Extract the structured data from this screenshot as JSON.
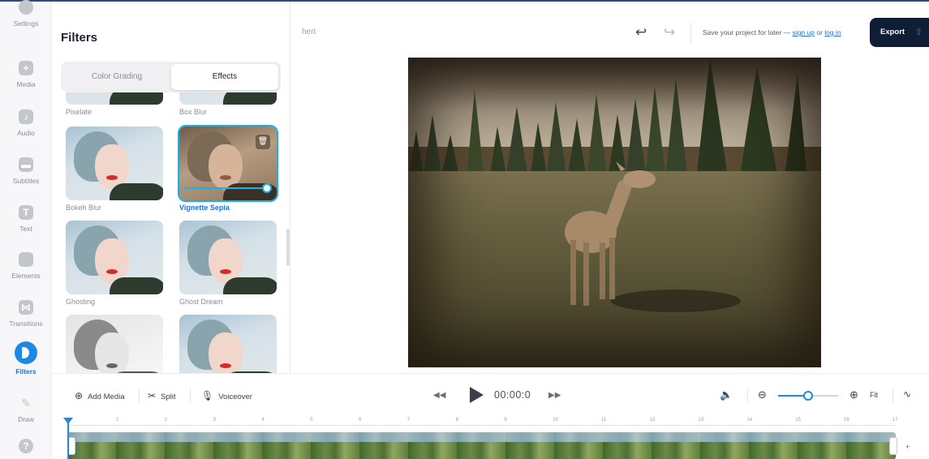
{
  "sidebar": {
    "items": [
      {
        "label": "Settings",
        "icon": "settings-icon"
      },
      {
        "label": "Media",
        "icon": "plus-icon"
      },
      {
        "label": "Audio",
        "icon": "music-note-icon"
      },
      {
        "label": "Subtitles",
        "icon": "subtitles-icon"
      },
      {
        "label": "Text",
        "icon": "text-icon"
      },
      {
        "label": "Elements",
        "icon": "elements-icon"
      },
      {
        "label": "Transitions",
        "icon": "transitions-icon"
      },
      {
        "label": "Filters",
        "icon": "filters-icon",
        "active": true
      },
      {
        "label": "Draw",
        "icon": "pen-icon"
      },
      {
        "label": "",
        "icon": "help-icon"
      }
    ]
  },
  "panel": {
    "title": "Filters",
    "tabs": [
      "Color Grading",
      "Effects"
    ],
    "active_tab": "Effects",
    "filters": [
      {
        "label": "Pixelate"
      },
      {
        "label": "Box Blur"
      },
      {
        "label": "Bokeh Blur"
      },
      {
        "label": "Vignette Sepia",
        "selected": true,
        "intensity": 1.0
      },
      {
        "label": "Ghosting"
      },
      {
        "label": "Ghost Dream"
      },
      {
        "label": ""
      },
      {
        "label": ""
      }
    ]
  },
  "topbar": {
    "project_name": "hert",
    "save_prefix": "Save your project for later —",
    "sign_up": "sign up",
    "or": "or",
    "log_in": "log in",
    "export_label": "Export"
  },
  "toolbar": {
    "add_media": "Add Media",
    "split": "Split",
    "voiceover": "Voiceover",
    "timecode": "00:00:0",
    "fit": "Fit",
    "zoom_level": 0.5
  },
  "timeline": {
    "ticks": [
      "1",
      "2",
      "3",
      "4",
      "5",
      "6",
      "7",
      "8",
      "9",
      "10",
      "11",
      "12",
      "13",
      "14",
      "15",
      "16",
      "17"
    ],
    "add_label": "+"
  },
  "colors": {
    "accent": "#1e88e5",
    "selected": "#1ab0e8",
    "export_bg": "#0f1d35"
  }
}
